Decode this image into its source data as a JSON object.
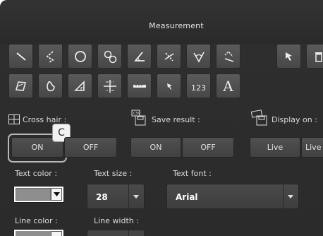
{
  "window": {
    "title": "Measurement"
  },
  "toolbar_row1": [
    {
      "name": "straight-line-icon"
    },
    {
      "name": "polyline-icon"
    },
    {
      "name": "circle-icon"
    },
    {
      "name": "circle-to-circle-icon"
    },
    {
      "name": "angle-icon"
    },
    {
      "name": "cross-angle-icon"
    },
    {
      "name": "arc-angle-icon"
    },
    {
      "name": "center-distance-icon"
    },
    {
      "name": "select-arrow-icon"
    },
    {
      "name": "trash-icon"
    }
  ],
  "toolbar_row2": [
    {
      "name": "area-icon"
    },
    {
      "name": "freehand-area-icon"
    },
    {
      "name": "triangle-icon"
    },
    {
      "name": "grid-cross-icon"
    },
    {
      "name": "scale-bar-icon"
    },
    {
      "name": "pointer-arrow-icon"
    },
    {
      "name": "counter-icon",
      "text": "123"
    },
    {
      "name": "text-icon",
      "text": "A"
    }
  ],
  "crosshair": {
    "label": "Cross hair :",
    "on": "ON",
    "off": "OFF"
  },
  "save_result": {
    "label": "Save result :",
    "on": "ON",
    "off": "OFF"
  },
  "display_on": {
    "label": "Display on :",
    "live": "Live",
    "live2": "Live"
  },
  "callout": {
    "letter": "C"
  },
  "text_color": {
    "label": "Text color :",
    "value": "#8e8e8e"
  },
  "text_size": {
    "label": "Text size :",
    "value": "28"
  },
  "text_font": {
    "label": "Text font :",
    "value": "Arial"
  },
  "line_color": {
    "label": "Line color :"
  },
  "line_width": {
    "label": "Line width :"
  }
}
